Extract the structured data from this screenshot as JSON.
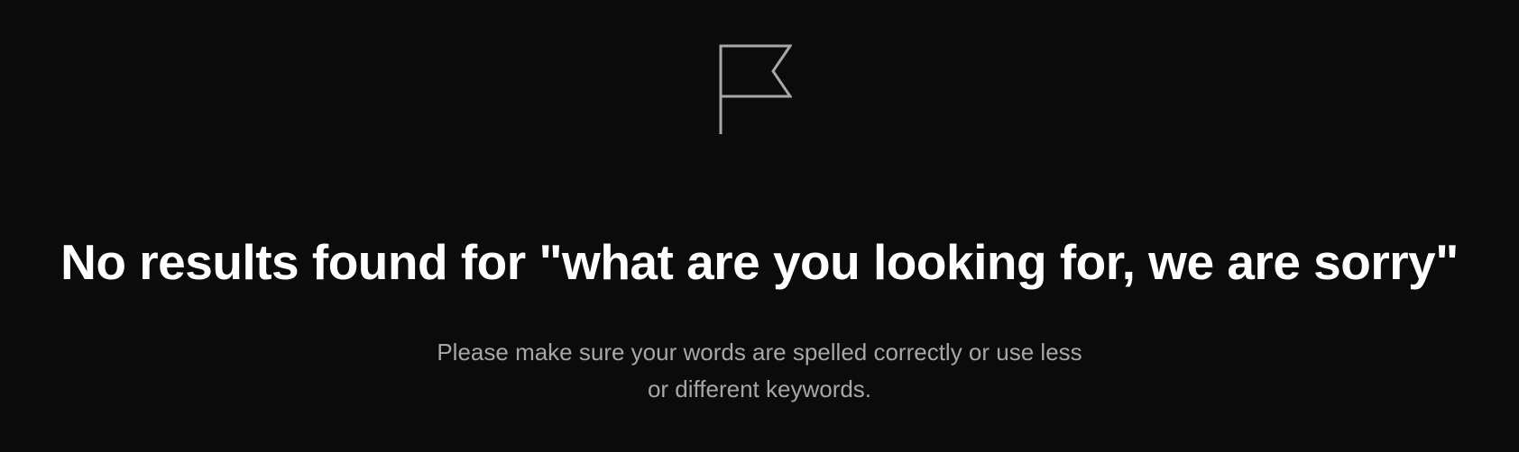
{
  "empty_state": {
    "icon": "flag-icon",
    "title": "No results found for \"what are you looking for, we are sorry\"",
    "message_line_1": "Please make sure your words are spelled correctly or use less",
    "message_line_2": "or different keywords."
  },
  "colors": {
    "background": "#0b0b0b",
    "title": "#ffffff",
    "message": "#a7a7a7",
    "icon": "#a7a7a7"
  }
}
